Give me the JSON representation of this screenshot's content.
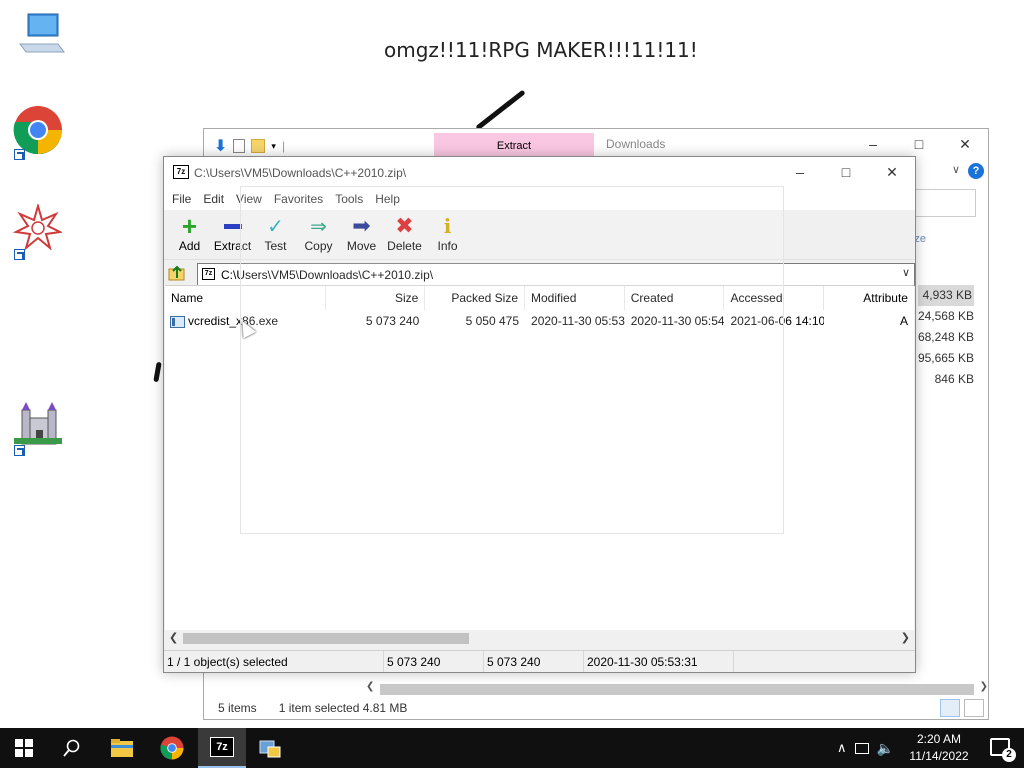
{
  "desktop": {
    "wallpaper_text": "omgz!!11!RPG MAKER!!!11!11!",
    "icons": [
      "computer-icon",
      "chrome-icon",
      "rpg-maker-icon",
      "castle-app-icon"
    ]
  },
  "explorer": {
    "ribbon_tab": "Extract",
    "title": "Downloads",
    "column_header": "ze",
    "file_sizes": [
      "4,933 KB",
      "24,568 KB",
      "68,248 KB",
      "95,665 KB",
      "846 KB"
    ],
    "status_items": "5 items",
    "status_selected": "1 item selected  4.81 MB"
  },
  "sevenzip": {
    "title": "C:\\Users\\VM5\\Downloads\\C++2010.zip\\",
    "menu": [
      "File",
      "Edit",
      "View",
      "Favorites",
      "Tools",
      "Help"
    ],
    "toolbar": {
      "add": "Add",
      "extract": "Extract",
      "test": "Test",
      "copy": "Copy",
      "move": "Move",
      "delete": "Delete",
      "info": "Info"
    },
    "address": "C:\\Users\\VM5\\Downloads\\C++2010.zip\\",
    "columns": {
      "name": "Name",
      "size": "Size",
      "packed": "Packed Size",
      "modified": "Modified",
      "created": "Created",
      "accessed": "Accessed",
      "attributes": "Attribute"
    },
    "rows": [
      {
        "name": "vcredist_x86.exe",
        "size": "5 073 240",
        "packed": "5 050 475",
        "modified": "2020-11-30 05:53",
        "created": "2020-11-30 05:54",
        "accessed": "2021-06-06 14:10",
        "attributes": "A"
      }
    ],
    "status": {
      "selection": "1 / 1 object(s) selected",
      "size": "5 073 240",
      "packed": "5 073 240",
      "modified": "2020-11-30 05:53:31"
    }
  },
  "taskbar": {
    "clock_time": "2:20 AM",
    "clock_date": "11/14/2022",
    "notification_count": "2"
  }
}
